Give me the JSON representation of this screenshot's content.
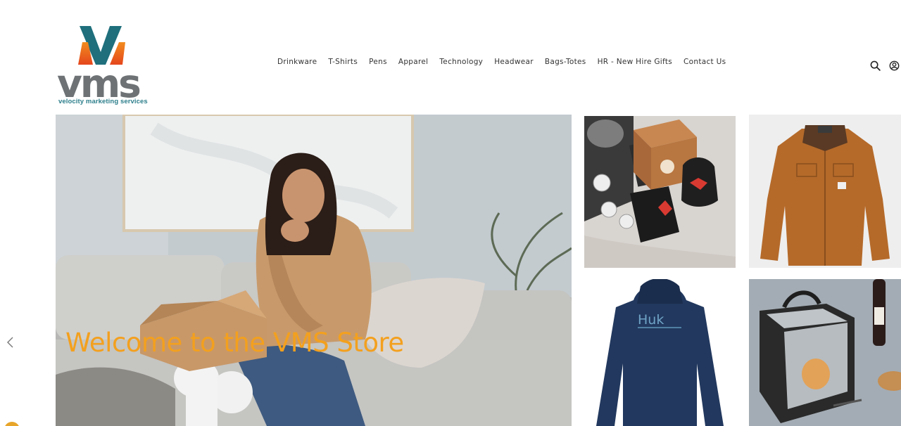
{
  "brand": {
    "logo_letters": "vms",
    "tagline": "velocity marketing services"
  },
  "nav": {
    "items": [
      {
        "label": "Drinkware"
      },
      {
        "label": "T-Shirts"
      },
      {
        "label": "Pens"
      },
      {
        "label": "Apparel"
      },
      {
        "label": "Technology"
      },
      {
        "label": "Headwear"
      },
      {
        "label": "Bags-Totes"
      },
      {
        "label": "HR - New Hire Gifts"
      },
      {
        "label": "Contact Us"
      }
    ]
  },
  "header_icons": [
    "search-icon",
    "user-account-icon"
  ],
  "hero": {
    "title": "Welcome to the VMS Store"
  },
  "tiles": [
    {
      "name": "gift-kit"
    },
    {
      "name": "work-jacket"
    },
    {
      "name": "hooded-shirt",
      "print": "Huk"
    },
    {
      "name": "cooler-bag"
    }
  ],
  "colors": {
    "accent_orange": "#f3a01e",
    "logo_teal": "#1f6f7c",
    "logo_grey": "#6e7275",
    "text": "#333333"
  }
}
